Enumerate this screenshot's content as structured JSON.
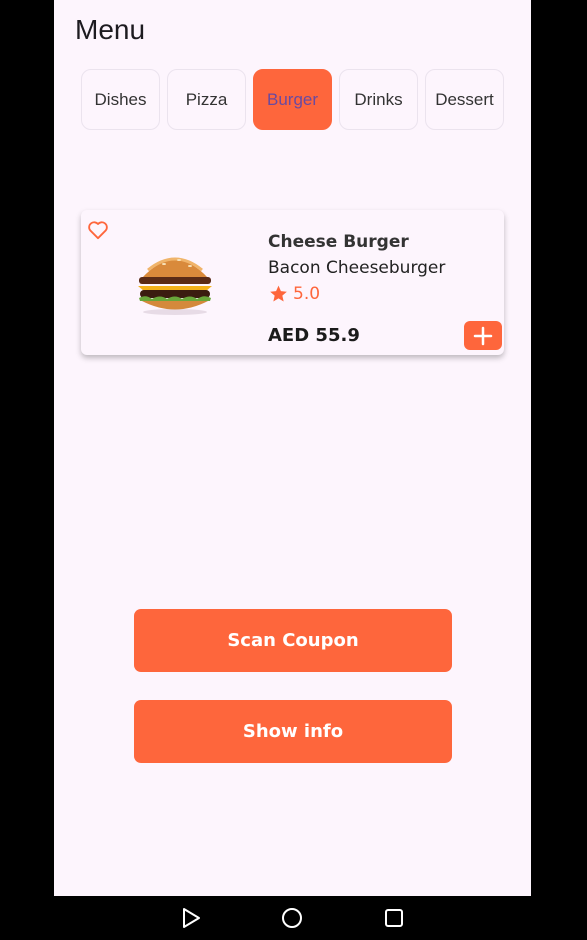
{
  "header": {
    "title": "Menu"
  },
  "tabs": [
    {
      "label": "Dishes"
    },
    {
      "label": "Pizza"
    },
    {
      "label": "Burger",
      "active": true
    },
    {
      "label": "Drinks"
    },
    {
      "label": "Dessert"
    }
  ],
  "item": {
    "name": "Cheese Burger",
    "subtitle": "Bacon Cheeseburger",
    "rating": "5.0",
    "price": "AED 55.9",
    "icons": {
      "favorite": "heart-outline-icon",
      "rating": "star-icon",
      "add": "plus-icon"
    }
  },
  "actions": {
    "scan_coupon": "Scan Coupon",
    "show_info": "Show info"
  },
  "colors": {
    "accent": "#fe663c",
    "background": "#fdf5fd",
    "active_tab_text": "#6a4aa0"
  },
  "navbar": {
    "icons": [
      "back-triangle-icon",
      "home-circle-icon",
      "recents-square-icon"
    ]
  }
}
